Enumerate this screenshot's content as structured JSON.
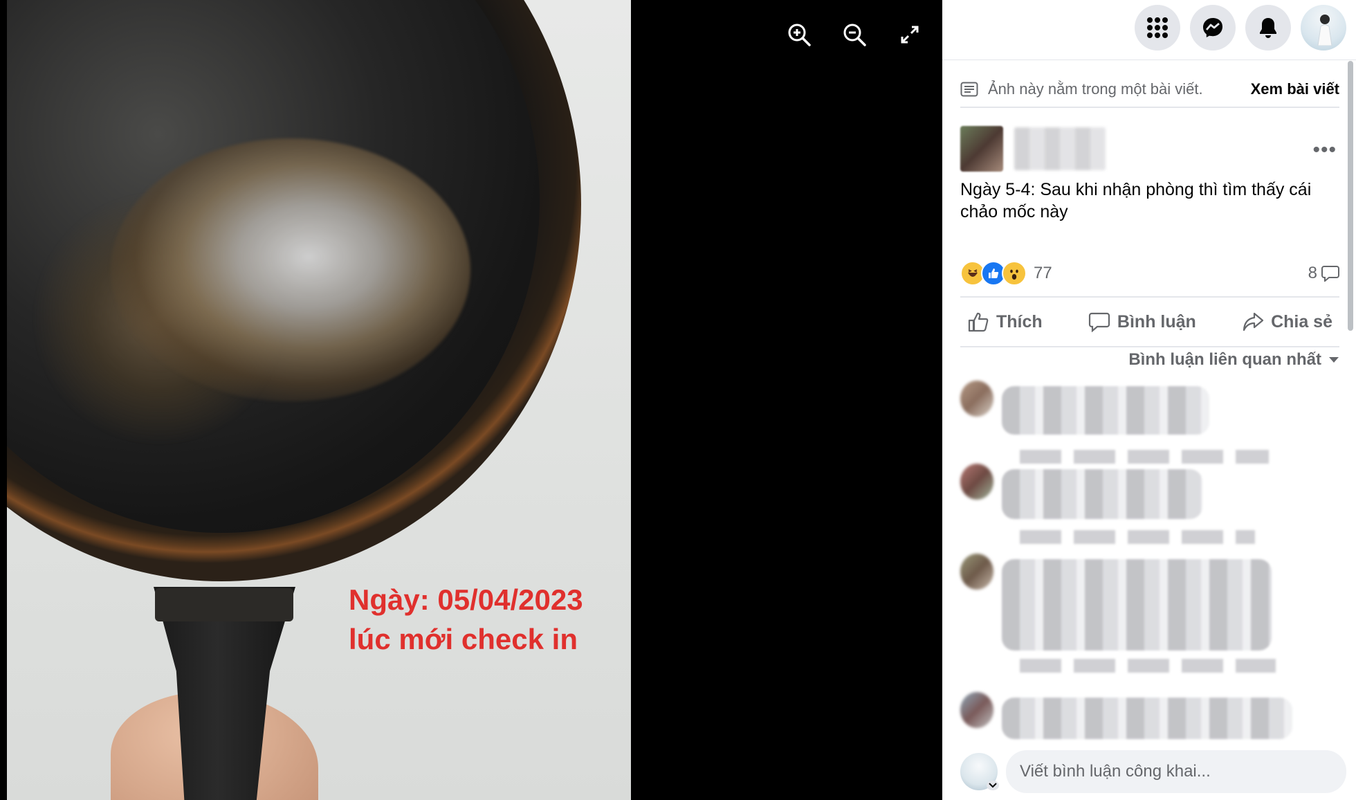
{
  "photo": {
    "caption_line1": "Ngày: 05/04/2023",
    "caption_line2": "lúc mới check in"
  },
  "viewer_tools": [
    "zoom-in-icon",
    "zoom-out-icon",
    "fullscreen-icon"
  ],
  "topbar": {
    "icons": [
      "menu-grid-icon",
      "messenger-icon",
      "bell-icon",
      "profile-avatar"
    ]
  },
  "notice": {
    "text": "Ảnh này nằm trong một bài viết.",
    "link": "Xem bài viết"
  },
  "post": {
    "text": "Ngày 5-4: Sau khi nhận phòng thì tìm thấy cái chảo mốc này",
    "more": "•••",
    "reactions": [
      "haha",
      "like",
      "wow"
    ],
    "reaction_count": "77",
    "comment_count": "8"
  },
  "actions": {
    "like": "Thích",
    "comment": "Bình luận",
    "share": "Chia sẻ"
  },
  "comments": {
    "sort_label": "Bình luận liên quan nhất"
  },
  "composer": {
    "placeholder": "Viết bình luận công khai..."
  },
  "colors": {
    "caption": "#e0302d",
    "like_blue": "#1877f2",
    "muted": "#65676b"
  }
}
